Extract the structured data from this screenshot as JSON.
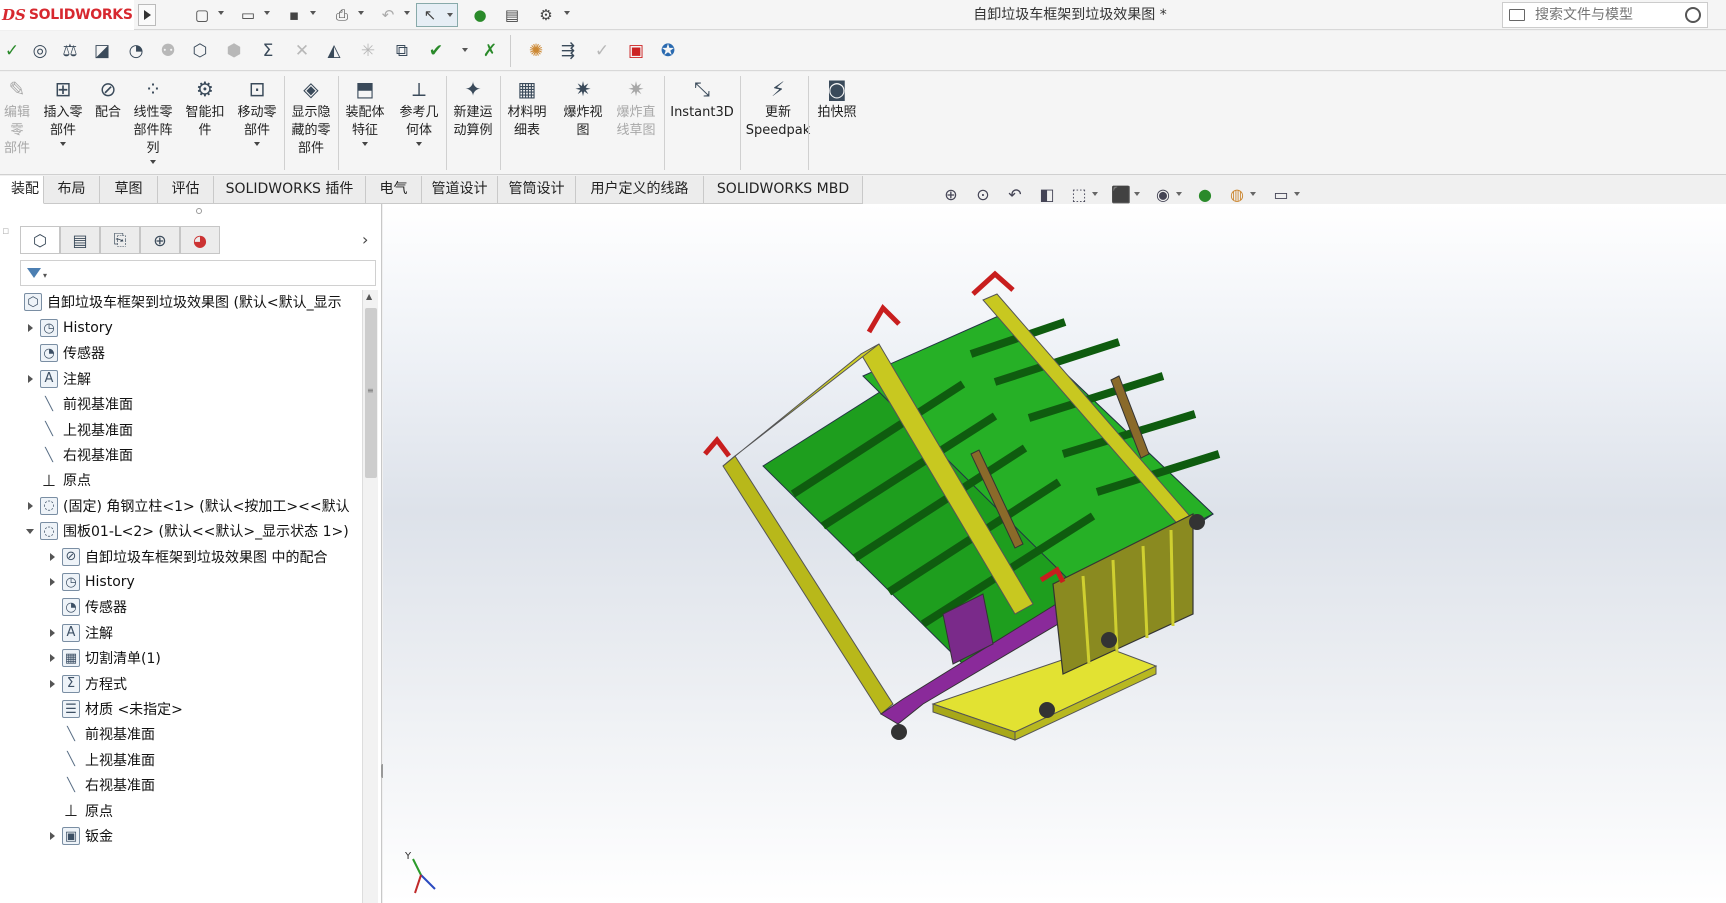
{
  "app": {
    "logo_ds": "DS",
    "logo_text": "SOLIDWORKS",
    "document_title": "自卸垃圾车框架到垃圾效果图 *"
  },
  "search": {
    "placeholder": "搜索文件与模型"
  },
  "quick_access": [
    "new-document",
    "open",
    "save",
    "print",
    "undo",
    "select",
    "rebuild",
    "file-properties",
    "options"
  ],
  "toolbar2_icons": [
    "spell-check",
    "measure",
    "mass-properties",
    "section-properties",
    "sensor",
    "interference",
    "clearance",
    "hole-alignment",
    "equations",
    "check",
    "performance",
    "assembly-visualization",
    "compare",
    "design-checker",
    "dimxpert",
    "isolate",
    "exploded",
    "costing",
    "publish",
    "help"
  ],
  "ribbon": {
    "buttons": [
      {
        "label": "编辑零\n部件",
        "dim": true
      },
      {
        "label": "插入零\n部件",
        "dim": false
      },
      {
        "label": "配合",
        "dim": false
      },
      {
        "label": "线性零\n部件阵\n列",
        "dim": false
      },
      {
        "label": "智能扣\n件",
        "dim": false
      },
      {
        "label": "移动零\n部件",
        "dim": false
      },
      {
        "label": "显示隐\n藏的零\n部件",
        "dim": false
      },
      {
        "label": "装配体\n特征",
        "dim": false
      },
      {
        "label": "参考几\n何体",
        "dim": false
      },
      {
        "label": "新建运\n动算例",
        "dim": false
      },
      {
        "label": "材料明\n细表",
        "dim": false
      },
      {
        "label": "爆炸视\n图",
        "dim": false
      },
      {
        "label": "爆炸直\n线草图",
        "dim": true
      },
      {
        "label": "Instant3D",
        "dim": false
      },
      {
        "label": "更新\nSpeedpak",
        "dim": false
      },
      {
        "label": "拍快照",
        "dim": false
      }
    ]
  },
  "tabs": [
    {
      "label": "装配体",
      "active": true
    },
    {
      "label": "布局",
      "active": false
    },
    {
      "label": "草图",
      "active": false
    },
    {
      "label": "评估",
      "active": false
    },
    {
      "label": "SOLIDWORKS 插件",
      "active": false
    },
    {
      "label": "电气",
      "active": false
    },
    {
      "label": "管道设计",
      "active": false
    },
    {
      "label": "管筒设计",
      "active": false
    },
    {
      "label": "用户定义的线路",
      "active": false
    },
    {
      "label": "SOLIDWORKS MBD",
      "active": false
    }
  ],
  "feature_tree": {
    "root": "自卸垃圾车框架到垃圾效果图 (默认<默认_显示",
    "items": [
      {
        "label": "History",
        "icon": "history",
        "expander": "closed",
        "level": 1
      },
      {
        "label": "传感器",
        "icon": "sensor",
        "expander": "none",
        "level": 1
      },
      {
        "label": "注解",
        "icon": "annotation",
        "expander": "closed",
        "level": 1
      },
      {
        "label": "前视基准面",
        "icon": "plane",
        "expander": "none",
        "level": 1
      },
      {
        "label": "上视基准面",
        "icon": "plane",
        "expander": "none",
        "level": 1
      },
      {
        "label": "右视基准面",
        "icon": "plane",
        "expander": "none",
        "level": 1
      },
      {
        "label": "原点",
        "icon": "origin",
        "expander": "none",
        "level": 1
      },
      {
        "label": "(固定) 角钢立柱<1> (默认<按加工><<默认",
        "icon": "part",
        "expander": "closed",
        "level": 1
      },
      {
        "label": "围板01-L<2> (默认<<默认>_显示状态 1>)",
        "icon": "part",
        "expander": "open",
        "level": 1
      },
      {
        "label": "自卸垃圾车框架到垃圾效果图 中的配合",
        "icon": "mates",
        "expander": "closed",
        "level": 2
      },
      {
        "label": "History",
        "icon": "history",
        "expander": "closed",
        "level": 2
      },
      {
        "label": "传感器",
        "icon": "sensor",
        "expander": "none",
        "level": 2
      },
      {
        "label": "注解",
        "icon": "annotation",
        "expander": "closed",
        "level": 2
      },
      {
        "label": "切割清单(1)",
        "icon": "cutlist",
        "expander": "closed",
        "level": 2
      },
      {
        "label": "方程式",
        "icon": "equation",
        "expander": "closed",
        "level": 2
      },
      {
        "label": "材质 <未指定>",
        "icon": "material",
        "expander": "none",
        "level": 2
      },
      {
        "label": "前视基准面",
        "icon": "plane",
        "expander": "none",
        "level": 2
      },
      {
        "label": "上视基准面",
        "icon": "plane",
        "expander": "none",
        "level": 2
      },
      {
        "label": "右视基准面",
        "icon": "plane",
        "expander": "none",
        "level": 2
      },
      {
        "label": "原点",
        "icon": "origin",
        "expander": "none",
        "level": 2
      },
      {
        "label": "钣金",
        "icon": "sheetmetal",
        "expander": "closed",
        "level": 2
      }
    ]
  },
  "triad": {
    "y_label": "Y"
  },
  "colors": {
    "bin_green": "#1e9e1e",
    "bin_green_dark": "#0f5c0f",
    "frame_olive": "#b8b81a",
    "frame_yellow": "#e0e020",
    "handle_red": "#c81e1e",
    "arm_brown": "#8a6a2a",
    "linkage_purple": "#8a2a9a",
    "brand_red": "#d7282f"
  }
}
